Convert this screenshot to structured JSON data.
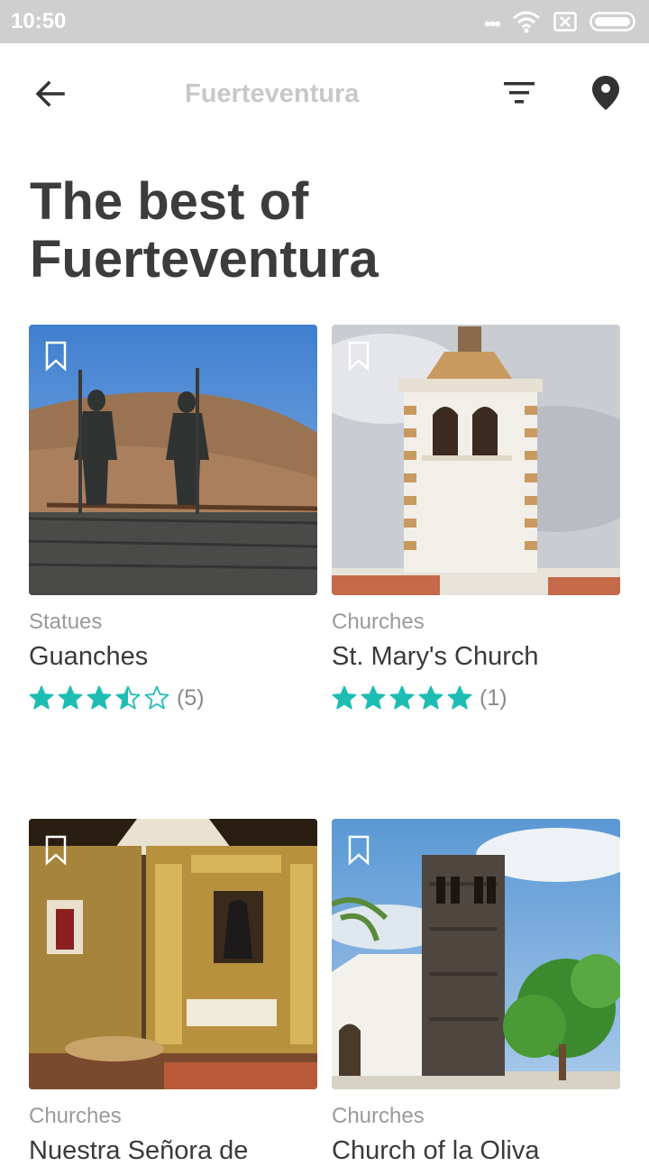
{
  "status_bar": {
    "time": "10:50"
  },
  "toolbar": {
    "title": "Fuerteventura"
  },
  "page": {
    "heading_line1": "The best of",
    "heading_line2": "Fuerteventura"
  },
  "colors": {
    "accent": "#1dbdb3",
    "heading": "#3c3c3c",
    "muted": "#9a9a9a"
  },
  "places": [
    {
      "category": "Statues",
      "title": "Guanches",
      "rating": 3.5,
      "reviews": "(5)"
    },
    {
      "category": "Churches",
      "title": "St. Mary's Church",
      "rating": 5,
      "reviews": "(1)"
    },
    {
      "category": "Churches",
      "title": "Nuestra Señora de",
      "rating": null,
      "reviews": ""
    },
    {
      "category": "Churches",
      "title": "Church of la Oliva",
      "rating": null,
      "reviews": ""
    }
  ]
}
